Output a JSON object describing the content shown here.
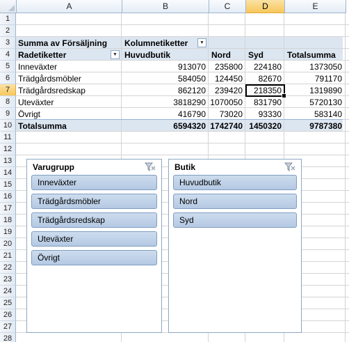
{
  "columns": [
    "A",
    "B",
    "C",
    "D",
    "E"
  ],
  "selected_column": "D",
  "rows": [
    "1",
    "2",
    "3",
    "4",
    "5",
    "6",
    "7",
    "8",
    "9",
    "10",
    "11",
    "12",
    "13",
    "14",
    "15",
    "16",
    "17",
    "18",
    "19",
    "20",
    "21",
    "22",
    "23",
    "24",
    "25",
    "26",
    "27",
    "28"
  ],
  "selected_row": "7",
  "pivot": {
    "values_label": "Summa av Försäljning",
    "column_labels": "Kolumnetiketter",
    "row_labels": "Radetiketter",
    "column_headers": [
      "Huvudbutik",
      "Nord",
      "Syd",
      "Totalsumma"
    ],
    "rows": [
      {
        "label": "Inneväxter",
        "values": [
          "913070",
          "235800",
          "224180",
          "1373050"
        ]
      },
      {
        "label": "Trädgårdsmöbler",
        "values": [
          "584050",
          "124450",
          "82670",
          "791170"
        ]
      },
      {
        "label": "Trädgårdsredskap",
        "values": [
          "862120",
          "239420",
          "218350",
          "1319890"
        ]
      },
      {
        "label": "Uteväxter",
        "values": [
          "3818290",
          "1070050",
          "831790",
          "5720130"
        ]
      },
      {
        "label": "Övrigt",
        "values": [
          "416790",
          "73020",
          "93330",
          "583140"
        ]
      }
    ],
    "total": {
      "label": "Totalsumma",
      "values": [
        "6594320",
        "1742740",
        "1450320",
        "9787380"
      ]
    }
  },
  "slicers": [
    {
      "title": "Varugrupp",
      "items": [
        "Inneväxter",
        "Trädgårdsmöbler",
        "Trädgårdsredskap",
        "Uteväxter",
        "Övrigt"
      ]
    },
    {
      "title": "Butik",
      "items": [
        "Huvudbutik",
        "Nord",
        "Syd"
      ]
    }
  ],
  "colors": {
    "pivot_band": "#dce6f1",
    "slicer_button": "#b8cce4",
    "selection": "#f7c75c"
  }
}
